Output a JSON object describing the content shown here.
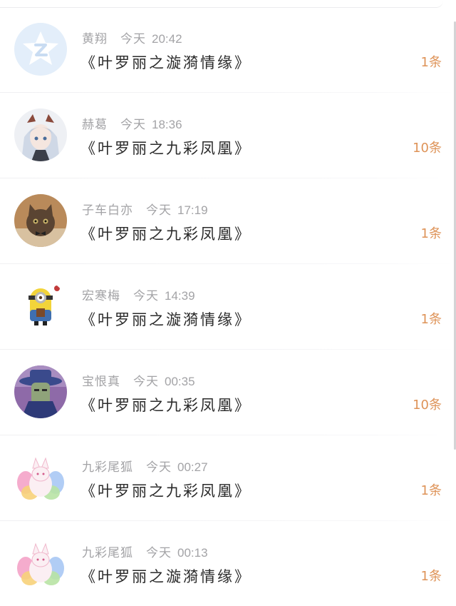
{
  "accent_color": "#de9358",
  "items": [
    {
      "name": "黄翔",
      "day": "今天",
      "time": "20:42",
      "title": "《叶罗丽之漩漪情缘》",
      "count": "1条",
      "avatar": "qq-star-avatar"
    },
    {
      "name": "赫葛",
      "day": "今天",
      "time": "18:36",
      "title": "《叶罗丽之九彩凤凰》",
      "count": "10条",
      "avatar": "anime-girl-avatar"
    },
    {
      "name": "子车白亦",
      "day": "今天",
      "time": "17:19",
      "title": "《叶罗丽之九彩凤凰》",
      "count": "1条",
      "avatar": "kitten-avatar"
    },
    {
      "name": "宏寒梅",
      "day": "今天",
      "time": "14:39",
      "title": "《叶罗丽之漩漪情缘》",
      "count": "1条",
      "avatar": "minion-avatar"
    },
    {
      "name": "宝恨真",
      "day": "今天",
      "time": "00:35",
      "title": "《叶罗丽之九彩凤凰》",
      "count": "10条",
      "avatar": "masked-figure-avatar"
    },
    {
      "name": "九彩尾狐",
      "day": "今天",
      "time": "00:27",
      "title": "《叶罗丽之九彩凤凰》",
      "count": "1条",
      "avatar": "nine-tailed-fox-avatar"
    },
    {
      "name": "九彩尾狐",
      "day": "今天",
      "time": "00:13",
      "title": "《叶罗丽之漩漪情缘》",
      "count": "1条",
      "avatar": "nine-tailed-fox-avatar"
    }
  ]
}
